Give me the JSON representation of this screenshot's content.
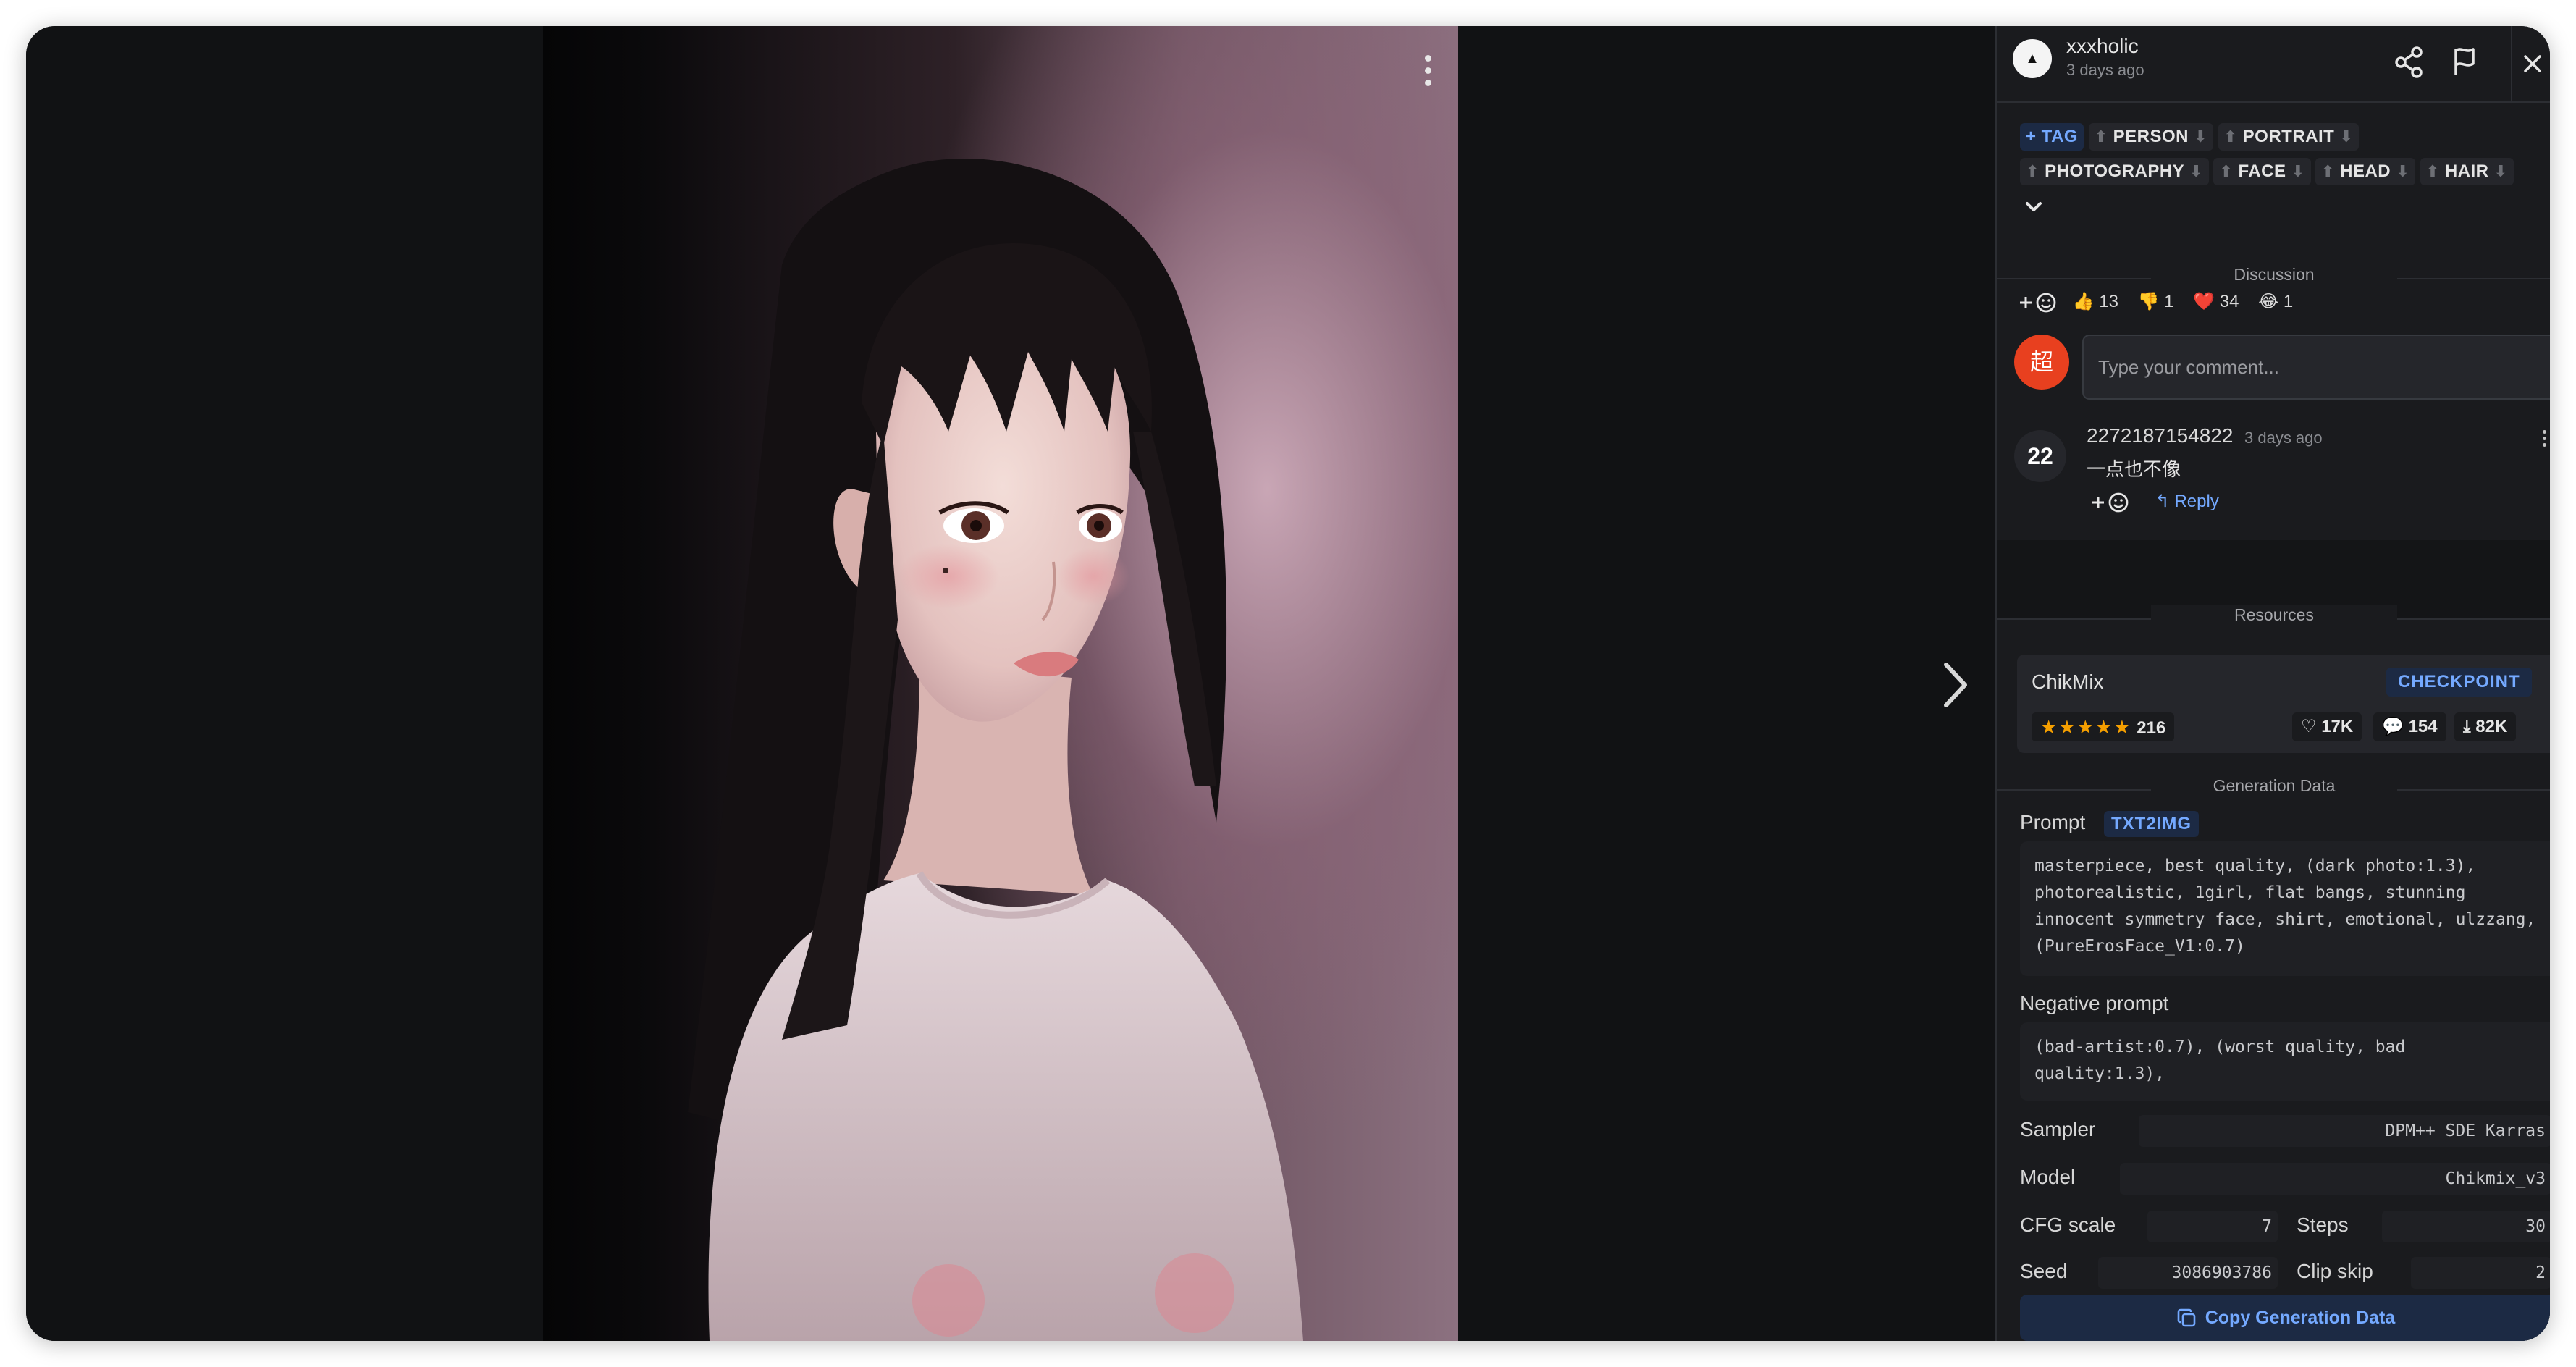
{
  "post": {
    "username": "xxxholic",
    "time": "3 days ago",
    "avatar_glyph": "▲"
  },
  "tags": {
    "add_label": "+ TAG",
    "items": [
      "PERSON",
      "PORTRAIT",
      "PHOTOGRAPHY",
      "FACE",
      "HEAD",
      "HAIR"
    ],
    "up_glyph": "⬆",
    "down_glyph": "⬇"
  },
  "discussion": {
    "title": "Discussion",
    "reactions": [
      {
        "emoji": "👍",
        "count": "13"
      },
      {
        "emoji": "👎",
        "count": "1"
      },
      {
        "emoji": "❤️",
        "count": "34"
      },
      {
        "emoji": "😂",
        "count": "1"
      }
    ],
    "my_avatar": "超",
    "input_placeholder": "Type your comment...",
    "comment": {
      "avatar": "22",
      "user": "2272187154822",
      "time": "3 days ago",
      "text": "一点也不像",
      "reply_label": "Reply"
    }
  },
  "resources": {
    "title": "Resources",
    "name": "ChikMix",
    "type": "CHECKPOINT",
    "rating_count": "216",
    "stars": 5,
    "likes": "17K",
    "comments": "154",
    "downloads": "82K"
  },
  "generation": {
    "title": "Generation Data",
    "prompt_label": "Prompt",
    "prompt_badge": "TXT2IMG",
    "prompt": "masterpiece, best quality, (dark photo:1.3), photorealistic, 1girl, flat bangs, stunning innocent symmetry face, shirt, emotional, ulzzang, (PureErosFace_V1:0.7)",
    "negative_label": "Negative prompt",
    "negative": "(bad-artist:0.7), (worst quality, bad quality:1.3),",
    "sampler_label": "Sampler",
    "sampler": "DPM++ SDE Karras",
    "model_label": "Model",
    "model": "Chikmix_v3",
    "cfg_label": "CFG scale",
    "cfg": "7",
    "steps_label": "Steps",
    "steps": "30",
    "seed_label": "Seed",
    "seed": "3086903786",
    "clip_label": "Clip skip",
    "clip": "2",
    "copy_label": "Copy Generation Data"
  },
  "carousel": {
    "total": 2,
    "active": 0
  },
  "colors": {
    "accent": "#74a9ff",
    "panel": "#1a1b1e",
    "bg": "#111214",
    "badge_bg": "#1c2a44"
  }
}
